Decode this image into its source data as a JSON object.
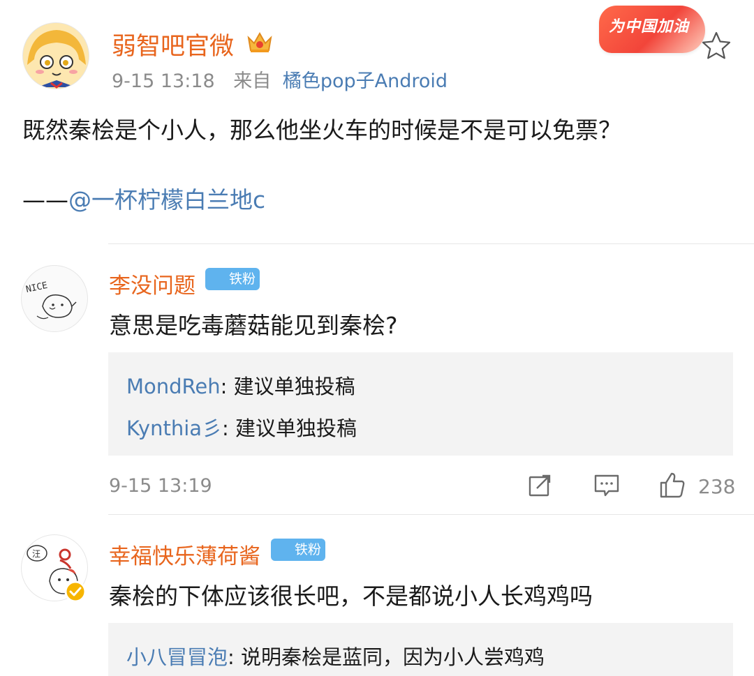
{
  "post": {
    "author": "弱智吧官微",
    "time": "9-15 13:18",
    "source_prefix": "来自",
    "source": "橘色pop子Android",
    "text": "既然秦桧是个小人，那么他坐火车的时候是不是可以免票？",
    "attribution_prefix": "——",
    "attribution": "@一杯柠檬白兰地c",
    "campaign_badge": "为中国加油"
  },
  "comments": [
    {
      "author": "李没问题",
      "badge": "铁粉",
      "text": "意思是吃毒蘑菇能见到秦桧?",
      "avatar_text": "NICE",
      "replies": [
        {
          "user": "MondReh",
          "sep": ": ",
          "text": "建议单独投稿"
        },
        {
          "user": "Kynthia彡",
          "sep": ": ",
          "text": "建议单独投稿"
        }
      ],
      "time": "9-15 13:19",
      "likes": "238"
    },
    {
      "author": "幸福快乐薄荷酱",
      "badge": "铁粉",
      "text": "秦桧的下体应该很长吧，不是都说小人长鸡鸡吗",
      "avatar_text": "汪",
      "replies": [
        {
          "user": "小八冒冒泡",
          "sep": ": ",
          "text": "说明秦桧是蓝同，因为小人尝鸡鸡"
        }
      ]
    }
  ],
  "colors": {
    "name": "#e8651d",
    "link": "#4a7cb3",
    "meta": "#8b8b8b",
    "fan_badge": "#5fb3ee",
    "reply_bg": "#f3f3f3"
  },
  "icons": {
    "crown": "crown-icon",
    "star": "star-icon",
    "share": "share-icon",
    "comment": "comment-icon",
    "like": "like-icon",
    "verified": "verified-icon"
  }
}
